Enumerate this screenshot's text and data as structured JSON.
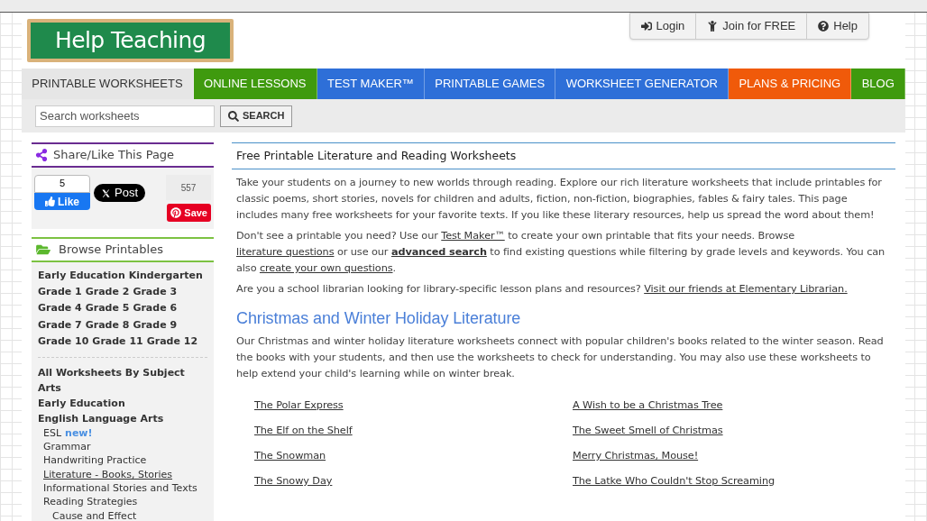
{
  "logo": {
    "text": "Help Teaching"
  },
  "account_links": [
    {
      "kind": "login",
      "label": "Login"
    },
    {
      "kind": "join",
      "label": "Join for FREE"
    },
    {
      "kind": "help",
      "label": "Help"
    }
  ],
  "nav": [
    {
      "label": "PRINTABLE WORKSHEETS",
      "selected": true,
      "color": "#e6e6e6"
    },
    {
      "label": "ONLINE LESSONS",
      "selected": false,
      "color": "#3f9a0e"
    },
    {
      "label": "TEST MAKER™",
      "selected": false,
      "color": "#2e6fd8"
    },
    {
      "label": "PRINTABLE GAMES",
      "selected": false,
      "color": "#2e6fd8"
    },
    {
      "label": "WORKSHEET GENERATOR",
      "selected": false,
      "color": "#2e6fd8"
    },
    {
      "label": "PLANS & PRICING",
      "selected": false,
      "color": "#f05a0a"
    },
    {
      "label": "BLOG",
      "selected": false,
      "color": "#3f9a0e"
    }
  ],
  "search": {
    "placeholder": "Search worksheets",
    "button": "SEARCH"
  },
  "share": {
    "title": "Share/Like This Page",
    "like_count": "5",
    "like": "Like",
    "post": "Post",
    "save_count": "557",
    "save": "Save"
  },
  "browse": {
    "title": "Browse Printables",
    "grade_rows": [
      [
        "Early Education",
        "Kindergarten"
      ],
      [
        "Grade 1",
        "Grade 2",
        "Grade 3"
      ],
      [
        "Grade 4",
        "Grade 5",
        "Grade 6"
      ],
      [
        "Grade 7",
        "Grade 8",
        "Grade 9"
      ],
      [
        "Grade 10",
        "Grade 11",
        "Grade 12"
      ]
    ],
    "subjects": [
      {
        "label": "All Worksheets By Subject",
        "kind": "main",
        "selected": false
      },
      {
        "label": "Arts",
        "kind": "main",
        "selected": false
      },
      {
        "label": "Early Education",
        "kind": "main",
        "selected": false
      },
      {
        "label": "English Language Arts",
        "kind": "main",
        "selected": false
      },
      {
        "label": "ESL",
        "kind": "sub",
        "selected": false,
        "badge": "new!"
      },
      {
        "label": "Grammar",
        "kind": "sub",
        "selected": false
      },
      {
        "label": "Handwriting Practice",
        "kind": "sub",
        "selected": false
      },
      {
        "label": "Literature - Books, Stories",
        "kind": "sub",
        "selected": true
      },
      {
        "label": "Informational Stories and Texts",
        "kind": "sub",
        "selected": false
      },
      {
        "label": "Reading Strategies",
        "kind": "sub",
        "selected": false
      },
      {
        "label": "Cause and Effect",
        "kind": "subsub",
        "selected": false
      }
    ]
  },
  "main": {
    "title": "Free Printable Literature and Reading Worksheets",
    "paragraphs": [
      [
        {
          "kind": "text",
          "text": "Take your students on a journey to new worlds through reading. Explore our rich literature worksheets that include printables for classic poems, short stories, novels for children and adults, fiction, non-fiction, biographies, fables & fairy tales. This page includes many free worksheets for your favorite texts. If you like these literary resources, help us spread the word about them!"
        }
      ],
      [
        {
          "kind": "text",
          "text": "Don't see a printable you need? Use our "
        },
        {
          "kind": "link",
          "text": "Test Maker™"
        },
        {
          "kind": "text",
          "text": " to create your own printable that fits your needs. Browse "
        },
        {
          "kind": "link",
          "text": "literature questions"
        },
        {
          "kind": "text",
          "text": " or use our "
        },
        {
          "kind": "bold_link",
          "text": "advanced search"
        },
        {
          "kind": "text",
          "text": " to find existing questions while filtering by grade levels and keywords. You can also "
        },
        {
          "kind": "link",
          "text": "create your own questions"
        },
        {
          "kind": "text",
          "text": "."
        }
      ],
      [
        {
          "kind": "text",
          "text": "Are you a school librarian looking for library-specific lesson plans and resources? "
        },
        {
          "kind": "link",
          "text": "Visit our friends at Elementary Librarian."
        }
      ]
    ],
    "section": {
      "heading": "Christmas and Winter Holiday Literature",
      "intro": "Our Christmas and winter holiday literature worksheets connect with popular children's books related to the winter season. Read the books with your students, and then use the worksheets to check for understanding. You may also use these worksheets to help extend your child's learning while on winter break.",
      "books": [
        "The Polar Express",
        "A Wish to be a Christmas Tree",
        "The Elf on the Shelf",
        "The Sweet Smell of Christmas",
        "The Snowman",
        "Merry Christmas, Mouse!",
        "The Snowy Day",
        "The Latke Who Couldn't Stop Screaming"
      ]
    }
  }
}
